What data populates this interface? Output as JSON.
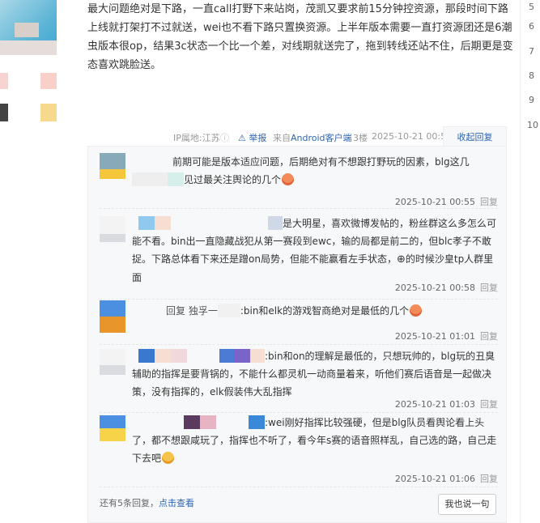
{
  "post": {
    "text": "最大问题绝对是下路，一直call打野下来站岗，茂凯又要求前15分钟控资源，那段时间下路上线就打架打不过就送，wei也不看下路只置换资源。上半年版本需要一直打资源团还是6潮虫版本很op，结果3c状态一个比一个差，对线期就送完了，拖到转线还站不住，后期更是变态喜欢跳脸送。",
    "ip_label": "IP属地:江苏",
    "report_label": "举报",
    "source_label": "来自Android客户端",
    "floor": "3楼",
    "timestamp": "2025-10-21 00:51",
    "fold_label": "收起回复"
  },
  "replies": [
    {
      "text_a": "前期可能是版本适应问题，后期绝对有不想跟打野玩的因素，blg这几",
      "text_b": "见过最关注舆论的几个",
      "time": "2025-10-21 00:55",
      "reply_label": "回复"
    },
    {
      "text_a": "是大明星，喜欢微博发帖的，粉丝群这么多怎么可能不看。bin出一直隐藏战犯从第一赛段到ewc，输的局都是前二的，但blc孝子不敢捉。下路总体看下来还是蹭on局势，但能不能赢看左手状态，",
      "text_b": "的时候沙皇tp人群里面",
      "time": "2025-10-21 00:58",
      "reply_label": "回复"
    },
    {
      "text_pre": "回复 独孚一",
      "text_a": ":bin和elk的游戏智商绝对是最低的几个",
      "time": "2025-10-21 01:01",
      "reply_label": "回复"
    },
    {
      "text_a": ":bin和on的理解是最低的，只想玩帅的，blg玩的丑臭辅助的指挥是要背锅的，不能什么都灵机一动商量着来，听他们赛后语音是一起做决策，没有指挥的，elk假装伟大乱指挥",
      "time": "2025-10-21 01:03",
      "reply_label": "回复"
    },
    {
      "text_a": ":wei刚好指挥比较强硬，但是blg队员看舆论看上头了，都不想跟咸玩了，指挥也不听了，看今年s赛的语音照样乱，自己选的路，自己走下去吧",
      "time": "2025-10-21 01:06",
      "reply_label": "回复"
    }
  ],
  "footer": {
    "more_prefix": "还有5条回复，",
    "more_link": "点击查看",
    "say_button": "我也说一句"
  },
  "right_numbers": [
    "5",
    "6",
    "7",
    "8",
    "9",
    "10"
  ]
}
